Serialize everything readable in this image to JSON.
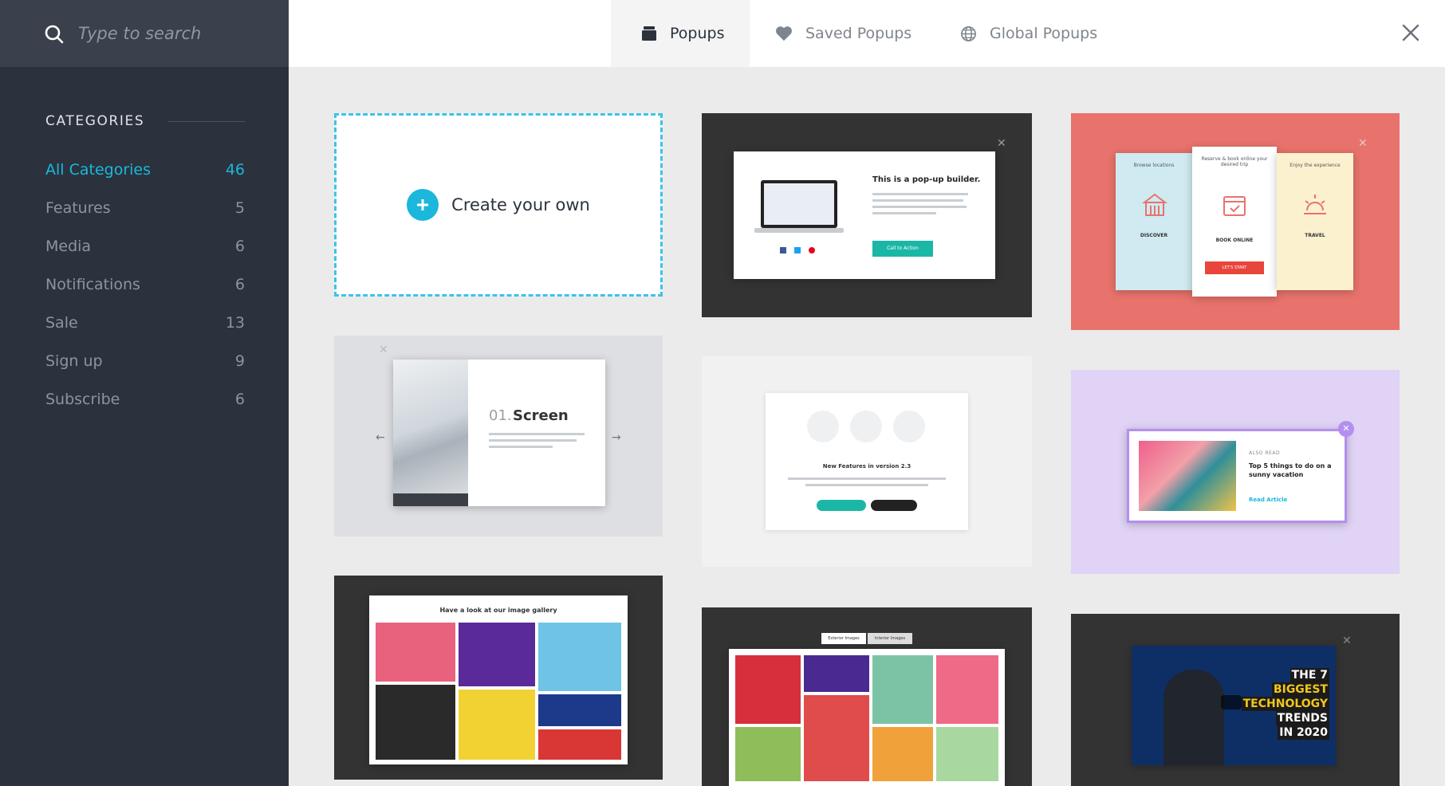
{
  "search": {
    "placeholder": "Type to search"
  },
  "sidebar": {
    "heading": "CATEGORIES",
    "categories": [
      {
        "label": "All Categories",
        "count": "46"
      },
      {
        "label": "Features",
        "count": "5"
      },
      {
        "label": "Media",
        "count": "6"
      },
      {
        "label": "Notifications",
        "count": "6"
      },
      {
        "label": "Sale",
        "count": "13"
      },
      {
        "label": "Sign up",
        "count": "9"
      },
      {
        "label": "Subscribe",
        "count": "6"
      }
    ]
  },
  "tabs": [
    {
      "label": "Popups",
      "icon": "folder-icon",
      "active": true
    },
    {
      "label": "Saved Popups",
      "icon": "heart-icon",
      "active": false
    },
    {
      "label": "Global Popups",
      "icon": "globe-icon",
      "active": false
    }
  ],
  "create": {
    "label": "Create your own"
  },
  "previews": {
    "builder": {
      "title": "This is a pop-up builder.",
      "button": "Call to Action"
    },
    "travel": {
      "steps": [
        "Browse locations",
        "Reserve & book online your desired trip",
        "Enjoy the experience"
      ],
      "labels": [
        "DISCOVER",
        "BOOK ONLINE",
        "TRAVEL"
      ],
      "button": "LET'S START"
    },
    "screen": {
      "number": "01.",
      "title": "Screen"
    },
    "features": {
      "title": "New Features in version 2.3"
    },
    "article": {
      "kicker": "ALSO READ",
      "title": "Top 5 things to do on a sunny vacation",
      "link": "Read Article"
    },
    "gallery": {
      "title": "Have a look at our image gallery"
    },
    "tabs_gallery": {
      "tabs": [
        "Exterior Images",
        "Interior Images"
      ]
    },
    "video": {
      "lines": [
        "THE 7",
        "BIGGEST",
        "TECHNOLOGY",
        "TRENDS",
        "IN 2020"
      ]
    }
  },
  "colors": {
    "accent": "#1bb7dc",
    "sidebar": "#2b323d",
    "search_bar": "#3a414c",
    "coral": "#e8736c",
    "lavender": "#e0d3f5"
  }
}
